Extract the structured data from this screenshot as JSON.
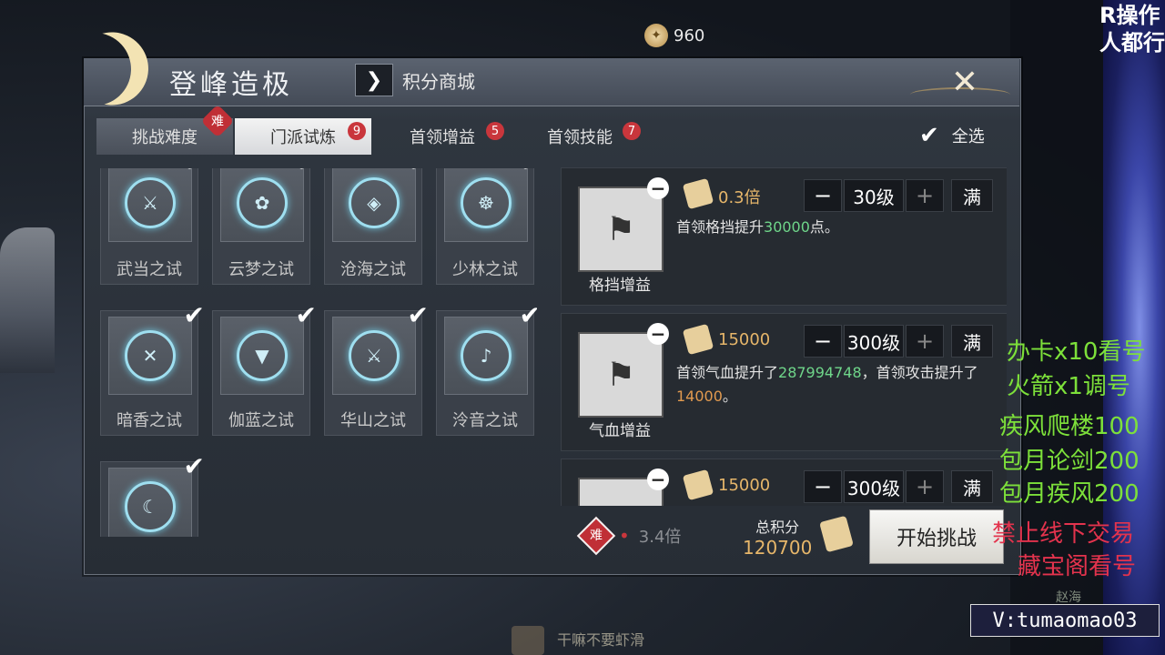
{
  "currency": {
    "value": "960",
    "icon": "soul-coin-icon"
  },
  "header": {
    "title": "登峰造极",
    "shop_link": "积分商城"
  },
  "tabs": [
    {
      "label": "挑战难度",
      "badge": "难"
    },
    {
      "label": "门派试炼",
      "badge": "9"
    },
    {
      "label": "首领增益",
      "badge": "5"
    },
    {
      "label": "首领技能",
      "badge": "7"
    }
  ],
  "select_all": "全选",
  "cards": [
    {
      "label": "武当之试",
      "checked": true
    },
    {
      "label": "云梦之试",
      "checked": true
    },
    {
      "label": "沧海之试",
      "checked": true
    },
    {
      "label": "少林之试",
      "checked": true
    },
    {
      "label": "暗香之试",
      "checked": true
    },
    {
      "label": "伽蓝之试",
      "checked": true
    },
    {
      "label": "华山之试",
      "checked": true
    },
    {
      "label": "泠音之试",
      "checked": true
    },
    {
      "label": "",
      "checked": true
    }
  ],
  "buffs": [
    {
      "name": "格挡增益",
      "multiplier": "0.3倍",
      "level": "30级",
      "max": "满",
      "desc_pre": "首领格挡提升",
      "desc_val": "30000",
      "desc_post": "点。"
    },
    {
      "name": "气血增益",
      "multiplier": "15000",
      "level": "300级",
      "max": "满",
      "desc_pre": "首领气血提升了",
      "desc_val": "287994748",
      "desc_mid": "，首领攻击提升了",
      "desc_val2": "14000",
      "desc_post": "。"
    },
    {
      "name": "",
      "multiplier": "15000",
      "level": "300级",
      "max": "满"
    }
  ],
  "footer": {
    "difficulty": "难",
    "multiplier": "3.4倍",
    "total_label": "总积分",
    "total_value": "120700",
    "start_button": "开始挑战"
  },
  "overlay": {
    "corner_line1": "R操作",
    "corner_line2": "人都行",
    "ad1": "办卡x10看号",
    "ad2": "火箭x1调号",
    "ad3": "疾风爬楼100",
    "ad4": "包月论剑200",
    "ad5": "包月疾风200",
    "ad6": "禁止线下交易",
    "ad7": "藏宝阁看号",
    "streamer": "V:tumaomao03",
    "small_name": "赵海",
    "chat": "干嘛不要虾滑"
  },
  "colors": {
    "accent_gold": "#e6b66a",
    "green": "#6fd68a",
    "orange": "#e19a4f",
    "badge_red": "#c9363c"
  }
}
